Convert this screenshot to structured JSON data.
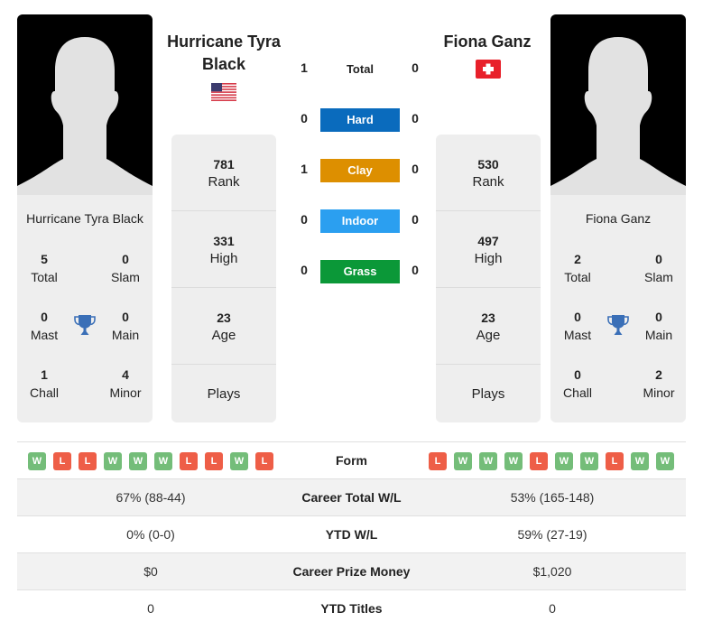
{
  "player1": {
    "name": "Hurricane Tyra Black",
    "name_line1": "Hurricane Tyra",
    "name_line2": "Black",
    "flag": "us-flag",
    "rank": "781",
    "rank_label": "Rank",
    "high": "331",
    "high_label": "High",
    "age": "23",
    "age_label": "Age",
    "plays_label": "Plays",
    "titles": {
      "total": "5",
      "total_label": "Total",
      "slam": "0",
      "slam_label": "Slam",
      "mast": "0",
      "mast_label": "Mast",
      "main": "0",
      "main_label": "Main",
      "chall": "1",
      "chall_label": "Chall",
      "minor": "4",
      "minor_label": "Minor"
    },
    "form": [
      "W",
      "L",
      "L",
      "W",
      "W",
      "W",
      "L",
      "L",
      "W",
      "L"
    ],
    "career_wl": "67% (88-44)",
    "ytd_wl": "0% (0-0)",
    "prize": "$0",
    "ytd_titles": "0"
  },
  "player2": {
    "name": "Fiona Ganz",
    "flag": "switzerland-flag",
    "rank": "530",
    "rank_label": "Rank",
    "high": "497",
    "high_label": "High",
    "age": "23",
    "age_label": "Age",
    "plays_label": "Plays",
    "titles": {
      "total": "2",
      "total_label": "Total",
      "slam": "0",
      "slam_label": "Slam",
      "mast": "0",
      "mast_label": "Mast",
      "main": "0",
      "main_label": "Main",
      "chall": "0",
      "chall_label": "Chall",
      "minor": "2",
      "minor_label": "Minor"
    },
    "form": [
      "L",
      "W",
      "W",
      "W",
      "L",
      "W",
      "W",
      "L",
      "W",
      "W"
    ],
    "career_wl": "53% (165-148)",
    "ytd_wl": "59% (27-19)",
    "prize": "$1,020",
    "ytd_titles": "0"
  },
  "h2h": {
    "total": {
      "label": "Total",
      "p1": "1",
      "p2": "0"
    },
    "surfaces": [
      {
        "label": "Hard",
        "p1": "0",
        "p2": "0",
        "color": "#0a6bbd"
      },
      {
        "label": "Clay",
        "p1": "1",
        "p2": "0",
        "color": "#dd8f00"
      },
      {
        "label": "Indoor",
        "p1": "0",
        "p2": "0",
        "color": "#2b9ff0"
      },
      {
        "label": "Grass",
        "p1": "0",
        "p2": "0",
        "color": "#0b9838"
      }
    ]
  },
  "table": {
    "form_label": "Form",
    "career_wl_label": "Career Total W/L",
    "ytd_wl_label": "YTD W/L",
    "prize_label": "Career Prize Money",
    "ytd_titles_label": "YTD Titles"
  }
}
